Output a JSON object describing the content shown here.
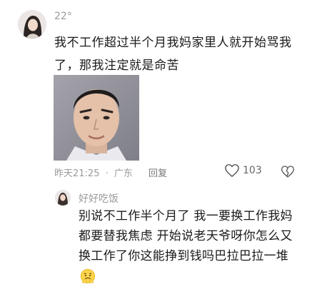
{
  "comment": {
    "username": "22°",
    "text": "我不工作超过半个月我妈家里人就开始骂我了，那我注定就是命苦",
    "time": "昨天21:25",
    "location": "广东",
    "reply_label": "回复",
    "like_count": "103"
  },
  "reply": {
    "username": "好好吃饭",
    "text": "别说不工作半个月了 我一要换工作我妈都要替我焦虑 开始说老天爷呀你怎么又换工作了你这能挣到钱吗巴拉巴拉一堆",
    "emoji": "anxious-face-emoji"
  },
  "colors": {
    "text_primary": "#1a1a1a",
    "text_secondary": "#9a9a9a",
    "background": "#ffffff"
  },
  "icons": {
    "like": "heart-outline-icon",
    "dislike": "broken-heart-icon"
  }
}
